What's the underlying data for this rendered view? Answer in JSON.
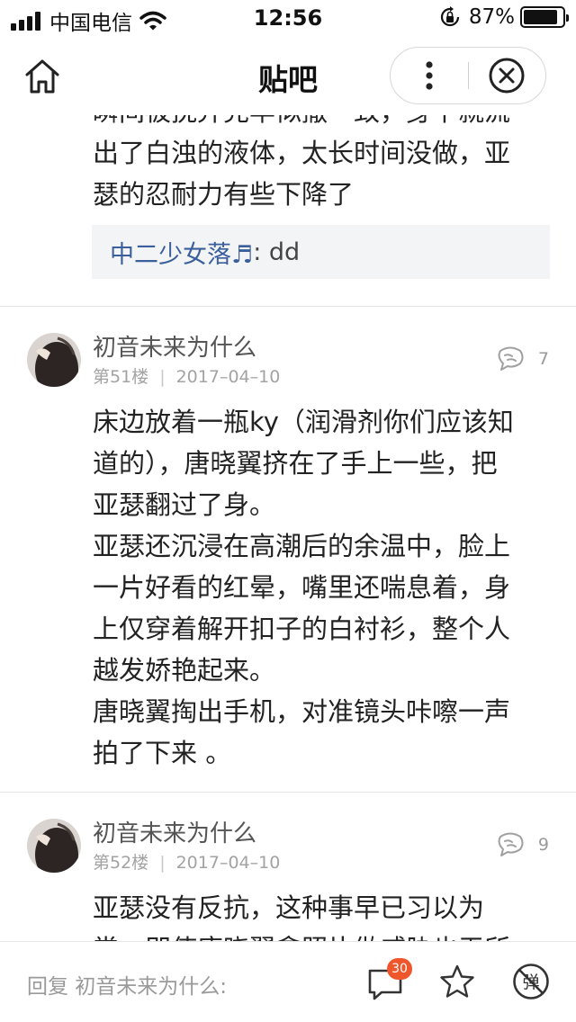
{
  "status_bar": {
    "carrier": "中国电信",
    "time": "12:56",
    "battery_percent": "87%",
    "battery_level": 0.87,
    "icons": [
      "signal-icon",
      "wifi-icon",
      "rotation-lock-icon",
      "battery-icon"
    ]
  },
  "nav": {
    "title": "贴吧",
    "icons": [
      "home-icon",
      "more-icon",
      "close-icon"
    ]
  },
  "previous_post": {
    "text_lines": [
      "瞬间被抚弄完毕似撒一致，身下就流",
      "出了白浊的液体，太长时间没做，亚",
      "瑟的忍耐力有些下降了"
    ],
    "quote": {
      "name": "中二少女落♬",
      "separator": ": ",
      "text": "dd"
    }
  },
  "posts": [
    {
      "author": "初音未来为什么",
      "floor": "第51楼",
      "date": "2017–04–10",
      "reply_count": "7",
      "lines": [
        "床边放着一瓶ky（润滑剂你们应该知",
        "道的），唐晓翼挤在了手上一些，把",
        "亚瑟翻过了身。",
        "亚瑟还沉浸在高潮后的余温中，脸上",
        "一片好看的红晕，嘴里还喘息着，身",
        "上仅穿着解开扣子的白衬衫，整个人",
        "越发娇艳起来。",
        "唐晓翼掏出手机，对准镜头咔嚓一声",
        "拍了下来 。"
      ]
    },
    {
      "author": "初音未来为什么",
      "floor": "第52楼",
      "date": "2017–04–10",
      "reply_count": "9",
      "lines": [
        "亚瑟没有反抗，这种事早已习以为",
        "常，即使唐晓翼拿照片做威胁也无所"
      ]
    }
  ],
  "bottom_bar": {
    "reply_placeholder": "回复 初音未来为什么:",
    "comment_count": "30",
    "icons": [
      "comment-icon",
      "star-icon",
      "danmu-off-icon"
    ],
    "danmu_glyph": "弹"
  }
}
